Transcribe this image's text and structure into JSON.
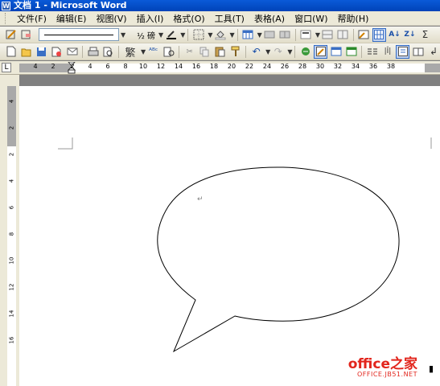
{
  "window": {
    "title": "文档 1 - Microsoft Word"
  },
  "menu": [
    "文件(F)",
    "编辑(E)",
    "视图(V)",
    "插入(I)",
    "格式(O)",
    "工具(T)",
    "表格(A)",
    "窗口(W)",
    "帮助(H)"
  ],
  "toolbar1": {
    "line_weight": "½ 磅",
    "icons": [
      "draw-line-icon",
      "border-color-icon",
      "line-style-dropdown",
      "line-weight-dropdown",
      "line-color-icon",
      "border-icon",
      "shading-icon",
      "insert-table-icon",
      "merge-cells-icon",
      "split-cells-icon",
      "align-icon",
      "distribute-rows-icon",
      "distribute-cols-icon",
      "table-autoformat-icon",
      "show-gridlines-icon",
      "sort-ascending-icon",
      "sort-descending-icon",
      "autosum-icon"
    ]
  },
  "toolbar2": {
    "convert_label": "繁",
    "zoom_partial": "10",
    "icons": [
      "new-icon",
      "open-icon",
      "save-icon",
      "permission-icon",
      "email-icon",
      "print-icon",
      "print-preview-icon",
      "spelling-icon",
      "research-icon",
      "cut-icon",
      "copy-icon",
      "paste-icon",
      "format-painter-icon",
      "undo-icon",
      "redo-icon",
      "hyperlink-icon",
      "tables-borders-icon",
      "insert-table-icon",
      "insert-excel-icon",
      "columns-icon",
      "drawing-icon",
      "document-map-icon",
      "show-hide-icon"
    ]
  },
  "ruler": {
    "corner": "L",
    "h_labels": [
      "4",
      "2",
      "2",
      "4",
      "6",
      "8",
      "10",
      "12",
      "14",
      "16",
      "18",
      "20",
      "22",
      "24",
      "26",
      "28",
      "30",
      "32",
      "34",
      "36",
      "38"
    ],
    "v_labels": [
      "4",
      "2",
      "2",
      "4",
      "6",
      "8",
      "10",
      "12",
      "14",
      "16"
    ]
  },
  "document": {
    "paragraph_mark": "↵",
    "shape": "speech-bubble-callout"
  },
  "watermark": {
    "main": "office之家",
    "sub": "OFFICE.JB51.NET"
  }
}
